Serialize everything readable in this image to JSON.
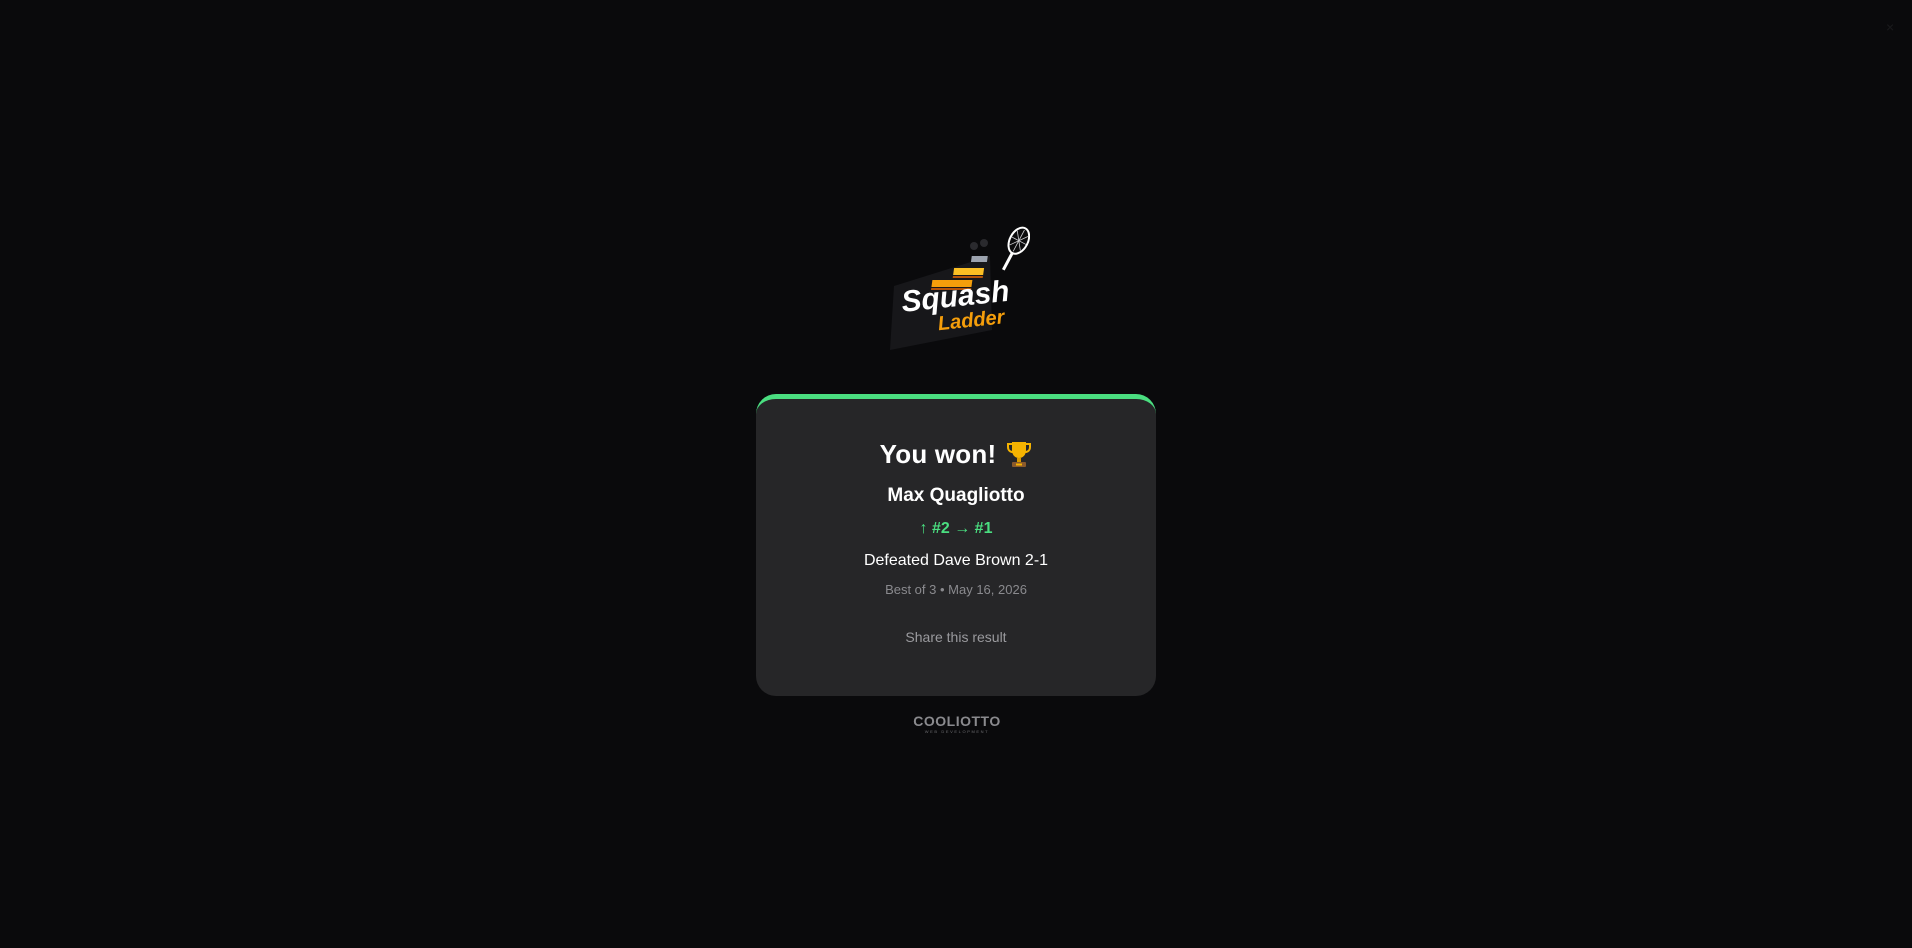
{
  "logo": {
    "line1": "Squash",
    "line2": "Ladder",
    "icon": "squash-ladder-logo"
  },
  "result_card": {
    "accent_color": "#4ade80",
    "title": "You won!",
    "title_icon": "trophy-icon",
    "player_name": "Max Quagliotto",
    "rank_change": "↑ #2 → #1",
    "result": "Defeated Dave Brown 2-1",
    "meta": "Best of 3 • May 16, 2026",
    "share_label": "Share this result"
  },
  "footer": {
    "brand_name": "COOLIOTTO",
    "brand_sub": "WEB DEVELOPMENT"
  },
  "colors": {
    "background": "#0a0a0c",
    "card": "#262628",
    "accent_green": "#4ade80",
    "brand_orange": "#f59e0b"
  }
}
